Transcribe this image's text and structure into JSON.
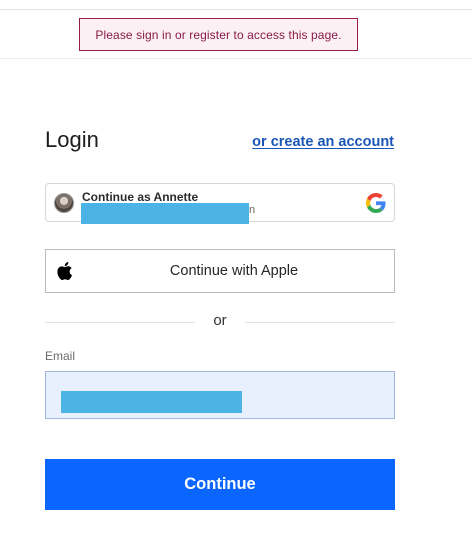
{
  "flash": {
    "message": "Please sign in or register to access this page."
  },
  "login": {
    "title": "Login",
    "create_account_link": "or create an account"
  },
  "google_button": {
    "name": "Continue as Annette",
    "email_tail": "n",
    "icon": "google-g-icon"
  },
  "apple_button": {
    "label": "Continue with Apple",
    "icon": "apple-icon"
  },
  "divider": {
    "label": "or"
  },
  "email": {
    "label": "Email"
  },
  "submit": {
    "label": "Continue"
  },
  "colors": {
    "primary": "#0a66ff",
    "link": "#1a56b8",
    "flash_border": "#9b1b4a",
    "redaction": "#4bb3e6",
    "input_bg": "#e8f0fd"
  }
}
